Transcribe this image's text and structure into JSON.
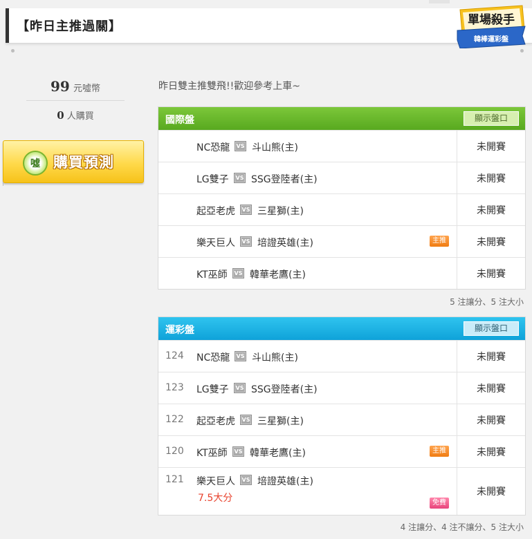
{
  "header": {
    "title": "【昨日主推過關】"
  },
  "logo": {
    "main": "單場殺手",
    "ribbon": "韓棒運彩盤"
  },
  "sidebar": {
    "price_value": "99",
    "price_unit": "元噓幣",
    "buyers_value": "0",
    "buyers_unit": "人購買",
    "buy_button": "購買預測",
    "coin_glyph": "噓"
  },
  "intro": "昨日雙主推雙飛!!歡迎參考上車~",
  "vs_label": "VS",
  "international": {
    "title": "國際盤",
    "show_button": "顯示盤口",
    "rows": [
      {
        "home": "NC恐龍",
        "away": "斗山熊(主)",
        "badge": "",
        "status": "未開賽"
      },
      {
        "home": "LG雙子",
        "away": "SSG登陸者(主)",
        "badge": "",
        "status": "未開賽"
      },
      {
        "home": "起亞老虎",
        "away": "三星獅(主)",
        "badge": "",
        "status": "未開賽"
      },
      {
        "home": "樂天巨人",
        "away": "培證英雄(主)",
        "badge": "主推",
        "status": "未開賽"
      },
      {
        "home": "KT巫師",
        "away": "韓華老鷹(主)",
        "badge": "",
        "status": "未開賽"
      }
    ],
    "summary": "5 注讓分、5 注大小"
  },
  "sportslottery": {
    "title": "運彩盤",
    "show_button": "顯示盤口",
    "rows": [
      {
        "no": "124",
        "home": "NC恐龍",
        "away": "斗山熊(主)",
        "badge": "",
        "status": "未開賽",
        "extra": ""
      },
      {
        "no": "123",
        "home": "LG雙子",
        "away": "SSG登陸者(主)",
        "badge": "",
        "status": "未開賽",
        "extra": ""
      },
      {
        "no": "122",
        "home": "起亞老虎",
        "away": "三星獅(主)",
        "badge": "",
        "status": "未開賽",
        "extra": ""
      },
      {
        "no": "120",
        "home": "KT巫師",
        "away": "韓華老鷹(主)",
        "badge": "主推",
        "status": "未開賽",
        "extra": ""
      },
      {
        "no": "121",
        "home": "樂天巨人",
        "away": "培證英雄(主)",
        "badge": "免費",
        "status": "未開賽",
        "extra": "7.5大分"
      }
    ],
    "summary": "4 注讓分、4 注不讓分、5 注大小"
  },
  "colors": {
    "green_header": "#6bb92c",
    "blue_header": "#1cb3e5",
    "badge_tui": "#f28a1e",
    "badge_free": "#ef5b8c",
    "extra_red": "#e8412c"
  }
}
